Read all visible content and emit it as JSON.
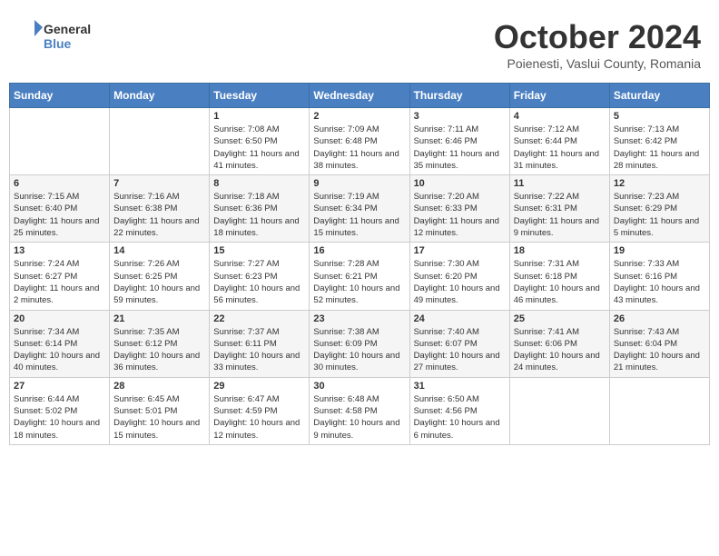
{
  "header": {
    "logo_general": "General",
    "logo_blue": "Blue",
    "month_title": "October 2024",
    "subtitle": "Poienesti, Vaslui County, Romania"
  },
  "days_of_week": [
    "Sunday",
    "Monday",
    "Tuesday",
    "Wednesday",
    "Thursday",
    "Friday",
    "Saturday"
  ],
  "weeks": [
    [
      {
        "day": "",
        "info": ""
      },
      {
        "day": "",
        "info": ""
      },
      {
        "day": "1",
        "info": "Sunrise: 7:08 AM\nSunset: 6:50 PM\nDaylight: 11 hours and 41 minutes."
      },
      {
        "day": "2",
        "info": "Sunrise: 7:09 AM\nSunset: 6:48 PM\nDaylight: 11 hours and 38 minutes."
      },
      {
        "day": "3",
        "info": "Sunrise: 7:11 AM\nSunset: 6:46 PM\nDaylight: 11 hours and 35 minutes."
      },
      {
        "day": "4",
        "info": "Sunrise: 7:12 AM\nSunset: 6:44 PM\nDaylight: 11 hours and 31 minutes."
      },
      {
        "day": "5",
        "info": "Sunrise: 7:13 AM\nSunset: 6:42 PM\nDaylight: 11 hours and 28 minutes."
      }
    ],
    [
      {
        "day": "6",
        "info": "Sunrise: 7:15 AM\nSunset: 6:40 PM\nDaylight: 11 hours and 25 minutes."
      },
      {
        "day": "7",
        "info": "Sunrise: 7:16 AM\nSunset: 6:38 PM\nDaylight: 11 hours and 22 minutes."
      },
      {
        "day": "8",
        "info": "Sunrise: 7:18 AM\nSunset: 6:36 PM\nDaylight: 11 hours and 18 minutes."
      },
      {
        "day": "9",
        "info": "Sunrise: 7:19 AM\nSunset: 6:34 PM\nDaylight: 11 hours and 15 minutes."
      },
      {
        "day": "10",
        "info": "Sunrise: 7:20 AM\nSunset: 6:33 PM\nDaylight: 11 hours and 12 minutes."
      },
      {
        "day": "11",
        "info": "Sunrise: 7:22 AM\nSunset: 6:31 PM\nDaylight: 11 hours and 9 minutes."
      },
      {
        "day": "12",
        "info": "Sunrise: 7:23 AM\nSunset: 6:29 PM\nDaylight: 11 hours and 5 minutes."
      }
    ],
    [
      {
        "day": "13",
        "info": "Sunrise: 7:24 AM\nSunset: 6:27 PM\nDaylight: 11 hours and 2 minutes."
      },
      {
        "day": "14",
        "info": "Sunrise: 7:26 AM\nSunset: 6:25 PM\nDaylight: 10 hours and 59 minutes."
      },
      {
        "day": "15",
        "info": "Sunrise: 7:27 AM\nSunset: 6:23 PM\nDaylight: 10 hours and 56 minutes."
      },
      {
        "day": "16",
        "info": "Sunrise: 7:28 AM\nSunset: 6:21 PM\nDaylight: 10 hours and 52 minutes."
      },
      {
        "day": "17",
        "info": "Sunrise: 7:30 AM\nSunset: 6:20 PM\nDaylight: 10 hours and 49 minutes."
      },
      {
        "day": "18",
        "info": "Sunrise: 7:31 AM\nSunset: 6:18 PM\nDaylight: 10 hours and 46 minutes."
      },
      {
        "day": "19",
        "info": "Sunrise: 7:33 AM\nSunset: 6:16 PM\nDaylight: 10 hours and 43 minutes."
      }
    ],
    [
      {
        "day": "20",
        "info": "Sunrise: 7:34 AM\nSunset: 6:14 PM\nDaylight: 10 hours and 40 minutes."
      },
      {
        "day": "21",
        "info": "Sunrise: 7:35 AM\nSunset: 6:12 PM\nDaylight: 10 hours and 36 minutes."
      },
      {
        "day": "22",
        "info": "Sunrise: 7:37 AM\nSunset: 6:11 PM\nDaylight: 10 hours and 33 minutes."
      },
      {
        "day": "23",
        "info": "Sunrise: 7:38 AM\nSunset: 6:09 PM\nDaylight: 10 hours and 30 minutes."
      },
      {
        "day": "24",
        "info": "Sunrise: 7:40 AM\nSunset: 6:07 PM\nDaylight: 10 hours and 27 minutes."
      },
      {
        "day": "25",
        "info": "Sunrise: 7:41 AM\nSunset: 6:06 PM\nDaylight: 10 hours and 24 minutes."
      },
      {
        "day": "26",
        "info": "Sunrise: 7:43 AM\nSunset: 6:04 PM\nDaylight: 10 hours and 21 minutes."
      }
    ],
    [
      {
        "day": "27",
        "info": "Sunrise: 6:44 AM\nSunset: 5:02 PM\nDaylight: 10 hours and 18 minutes."
      },
      {
        "day": "28",
        "info": "Sunrise: 6:45 AM\nSunset: 5:01 PM\nDaylight: 10 hours and 15 minutes."
      },
      {
        "day": "29",
        "info": "Sunrise: 6:47 AM\nSunset: 4:59 PM\nDaylight: 10 hours and 12 minutes."
      },
      {
        "day": "30",
        "info": "Sunrise: 6:48 AM\nSunset: 4:58 PM\nDaylight: 10 hours and 9 minutes."
      },
      {
        "day": "31",
        "info": "Sunrise: 6:50 AM\nSunset: 4:56 PM\nDaylight: 10 hours and 6 minutes."
      },
      {
        "day": "",
        "info": ""
      },
      {
        "day": "",
        "info": ""
      }
    ]
  ]
}
